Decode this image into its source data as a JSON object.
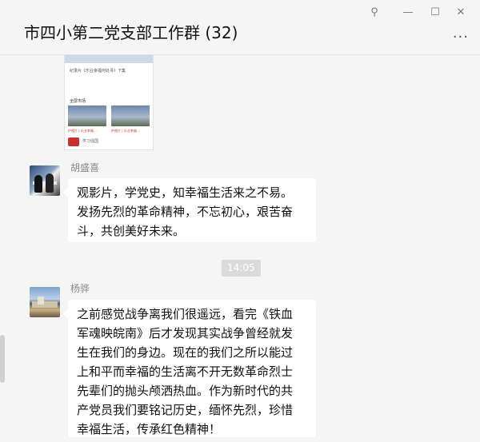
{
  "window": {
    "title": "市四小第二党支部工作群 (32)",
    "controls": {
      "pin": "⚲",
      "minimize": "—",
      "maximize": "☐",
      "close": "✕"
    },
    "more": "···"
  },
  "messages": [
    {
      "type": "card",
      "card": {
        "heading": "纪录片《乐业幸福何处寻》下集",
        "section": "全屏市场",
        "caption_left": "护视片 | 乐业幸福…",
        "caption_right": "护视片 | 乐业幸福…",
        "app_name": "学习强国"
      }
    },
    {
      "type": "text",
      "sender": "胡盛喜",
      "lines": [
        "观影片，学党史，知幸福生活来之不易。",
        "发扬先烈的革命精神，不忘初心，艰苦奋",
        "斗，共创美好未来。"
      ]
    },
    {
      "type": "time",
      "text": "14:05"
    },
    {
      "type": "text",
      "sender": "杨骅",
      "lines": [
        "之前感觉战争离我们很遥远，看完《铁血",
        "军魂映皖南》后才发现其实战争曾经就发",
        "生在我们的身边。现在的我们之所以能过",
        "上和平而幸福的生活离不开无数革命烈士",
        "先辈们的抛头颅洒热血。作为新时代的共",
        "产党员我们要铭记历史，缅怀先烈，珍惜",
        "幸福生活，传承红色精神！"
      ]
    }
  ]
}
